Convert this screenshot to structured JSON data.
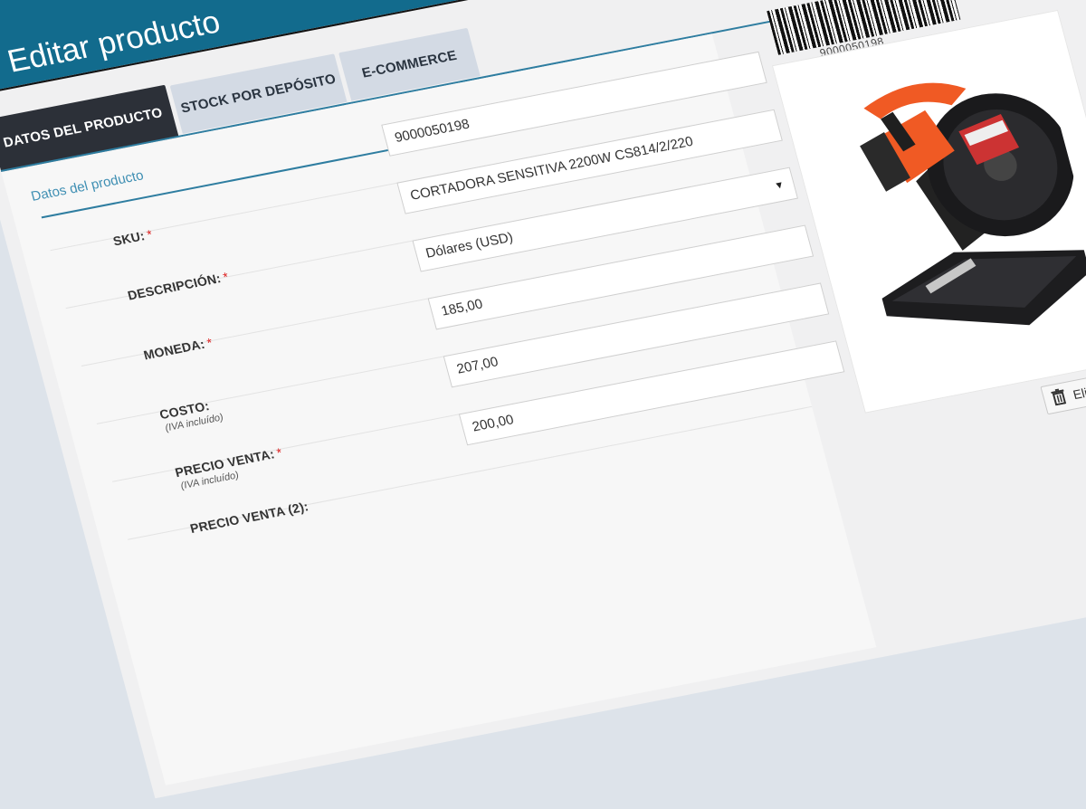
{
  "page": {
    "title": "Editar producto"
  },
  "tabs": [
    {
      "label": "DATOS DEL PRODUCTO",
      "active": true
    },
    {
      "label": "STOCK POR DEPÓSITO",
      "active": false
    },
    {
      "label": "E-COMMERCE",
      "active": false
    }
  ],
  "section": {
    "title": "Datos del producto"
  },
  "fields": {
    "sku": {
      "label": "SKU:",
      "required_mark": "*",
      "value": "9000050198"
    },
    "descripcion": {
      "label": "DESCRIPCIÓN:",
      "required_mark": "*",
      "value": "CORTADORA SENSITIVA 2200W CS814/2/220"
    },
    "moneda": {
      "label": "MONEDA:",
      "required_mark": "*",
      "value": "Dólares (USD)"
    },
    "costo": {
      "label": "COSTO:",
      "sublabel": "(IVA incluído)",
      "value": "185,00"
    },
    "precio_venta": {
      "label": "PRECIO VENTA:",
      "required_mark": "*",
      "sublabel": "(IVA incluído)",
      "value": "207,00"
    },
    "precio_venta2": {
      "label": "PRECIO VENTA (2):",
      "value": "200,00"
    }
  },
  "product_image": {
    "barcode_number": "9000050198",
    "delete_label": "Eliminar"
  },
  "colors": {
    "header": "#126b8d",
    "active_tab": "#2c3038",
    "accent": "#3f8fb3",
    "required": "#dd2222"
  }
}
